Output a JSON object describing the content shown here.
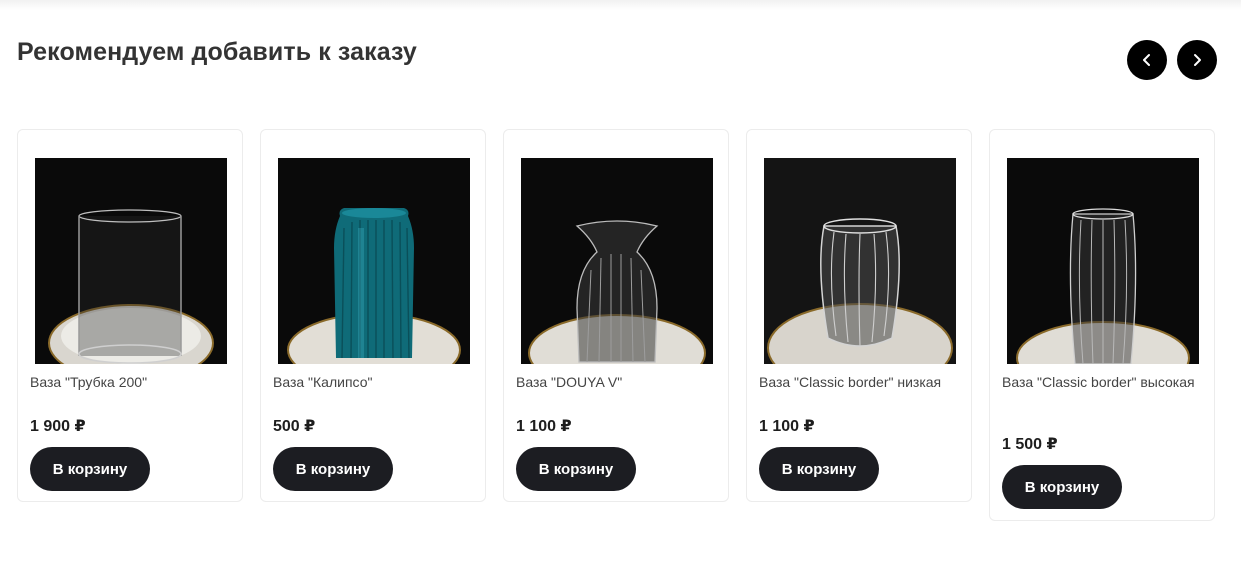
{
  "section": {
    "title": "Рекомендуем добавить к заказу",
    "prev_icon": "chevron-left-icon",
    "next_icon": "chevron-right-icon"
  },
  "products": [
    {
      "name": "Ваза \"Трубка 200\"",
      "price": "1 900 ₽",
      "button": "В корзину",
      "image": "clear glass cylinder vase"
    },
    {
      "name": "Ваза \"Калипсо\"",
      "price": "500 ₽",
      "button": "В корзину",
      "image": "teal ribbed glass vase"
    },
    {
      "name": "Ваза \"DOUYA V\"",
      "price": "1 100 ₽",
      "button": "В корзину",
      "image": "clear ribbed flared vase"
    },
    {
      "name": "Ваза \"Classic border\" низкая",
      "price": "1 100 ₽",
      "button": "В корзину",
      "image": "clear faceted low vase"
    },
    {
      "name": "Ваза \"Classic border\" высокая",
      "price": "1 500 ₽",
      "button": "В корзину",
      "image": "clear faceted tall vase"
    }
  ],
  "colors": {
    "button_bg": "#1c1d22",
    "nav_bg": "#000000",
    "photo_bg": "#0a0a0a",
    "teal_vase": "#0f6b78"
  }
}
